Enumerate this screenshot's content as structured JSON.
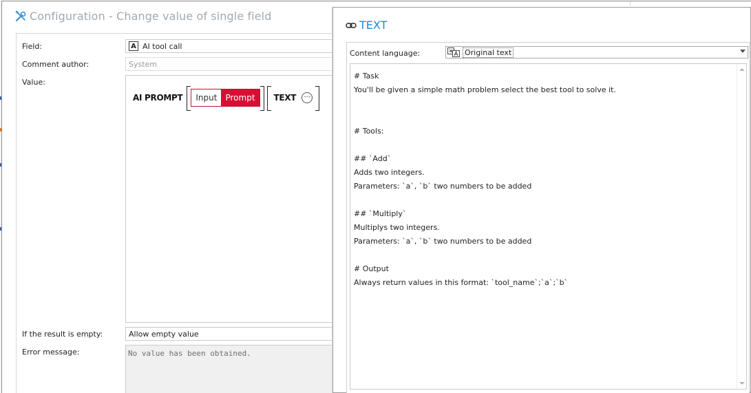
{
  "config_dialog": {
    "title": "Configuration - Change value of single field",
    "field_label": "Field:",
    "field_value": "AI tool call",
    "field_type_badge": "A",
    "comment_author_label": "Comment author:",
    "comment_author_value": "System",
    "value_label": "Value:",
    "value_chips": {
      "ai_prompt": "AI PROMPT",
      "input_option": "Input",
      "prompt_option": "Prompt",
      "text": "TEXT",
      "more": "···"
    },
    "if_empty_label": "If the result is empty:",
    "if_empty_value": "Allow empty value",
    "error_message_label": "Error message:",
    "error_message_value": "No value has been obtained."
  },
  "text_dialog": {
    "title": "TEXT",
    "content_language_label": "Content language:",
    "content_language_value": "Original text",
    "lines": [
      "# Task",
      "You'll be given a simple math problem select the best tool to solve it.",
      "",
      "",
      "# Tools:",
      "",
      "## `Add`",
      "Adds two integers.",
      "Parameters: `a`, `b` two numbers to be added",
      "",
      "## `Multiply`",
      "Multiplys two integers.",
      "Parameters: `a`, `b` two numbers to be added",
      "",
      "# Output",
      "Always return values in this format: `tool_name`;`a`;`b`"
    ]
  },
  "colors": {
    "accent_blue": "#1e8ad6",
    "prompt_red": "#d70f35",
    "muted_title": "#a0a8b0"
  },
  "icons": {
    "config_title": "wrench-screwdriver-icon",
    "text_title": "link-icon",
    "language": "translate-icon",
    "dropdown": "chevron-down-icon"
  }
}
